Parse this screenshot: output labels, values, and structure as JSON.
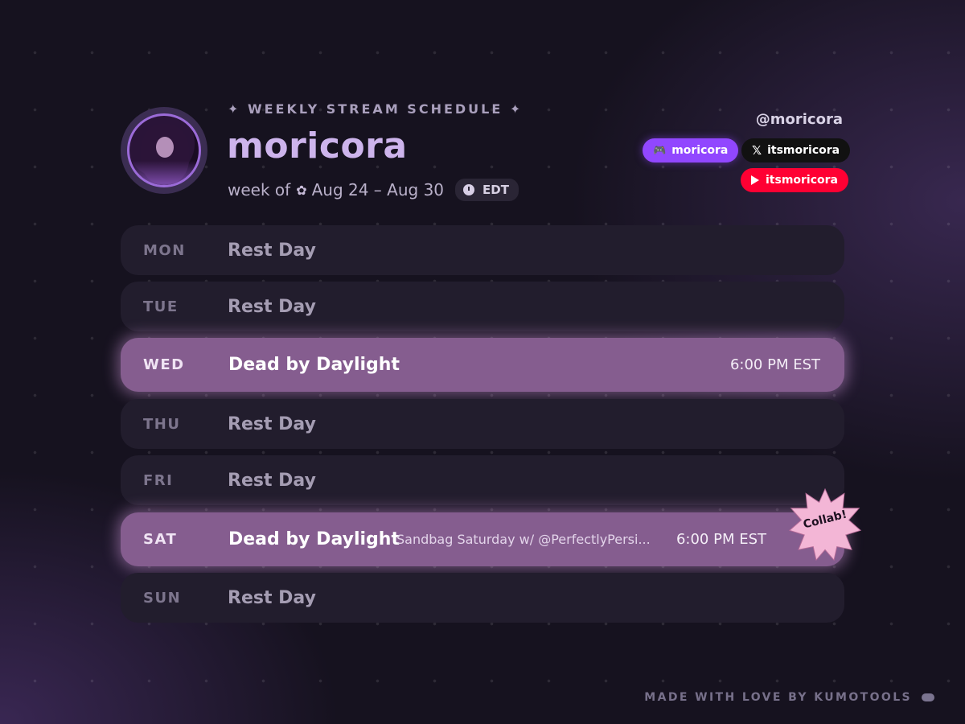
{
  "header": {
    "subtitle": "✦ WEEKLY STREAM SCHEDULE ✦",
    "name": "moricora",
    "week_prefix": "week of",
    "week_range": "Aug 24 – Aug 30",
    "timezone": "EDT"
  },
  "socials": {
    "handle": "@moricora",
    "twitch": "moricora",
    "x": "itsmoricora",
    "youtube": "itsmoricora",
    "colors": {
      "twitch": "#9147ff",
      "x": "#111111",
      "youtube": "#ff0033"
    }
  },
  "schedule": [
    {
      "day": "MON",
      "title": "Rest Day",
      "note": "",
      "time": "",
      "active": false
    },
    {
      "day": "TUE",
      "title": "Rest Day",
      "note": "",
      "time": "",
      "active": false
    },
    {
      "day": "WED",
      "title": "Dead by Daylight",
      "note": "",
      "time": "6:00 PM EST",
      "active": true
    },
    {
      "day": "THU",
      "title": "Rest Day",
      "note": "",
      "time": "",
      "active": false
    },
    {
      "day": "FRI",
      "title": "Rest Day",
      "note": "",
      "time": "",
      "active": false
    },
    {
      "day": "SAT",
      "title": "Dead by Daylight",
      "note": "Sandbag Saturday w/ @PerfectlyPersi...",
      "time": "6:00 PM EST",
      "active": true,
      "badge": "Collab!"
    },
    {
      "day": "SUN",
      "title": "Rest Day",
      "note": "",
      "time": "",
      "active": false
    }
  ],
  "footer": "MADE WITH LOVE BY KUMOTOOLS",
  "theme": {
    "accent": "#cdb4ec",
    "active_row": "#855d8f",
    "rest_row": "#221d2d",
    "background": "#16121f"
  }
}
